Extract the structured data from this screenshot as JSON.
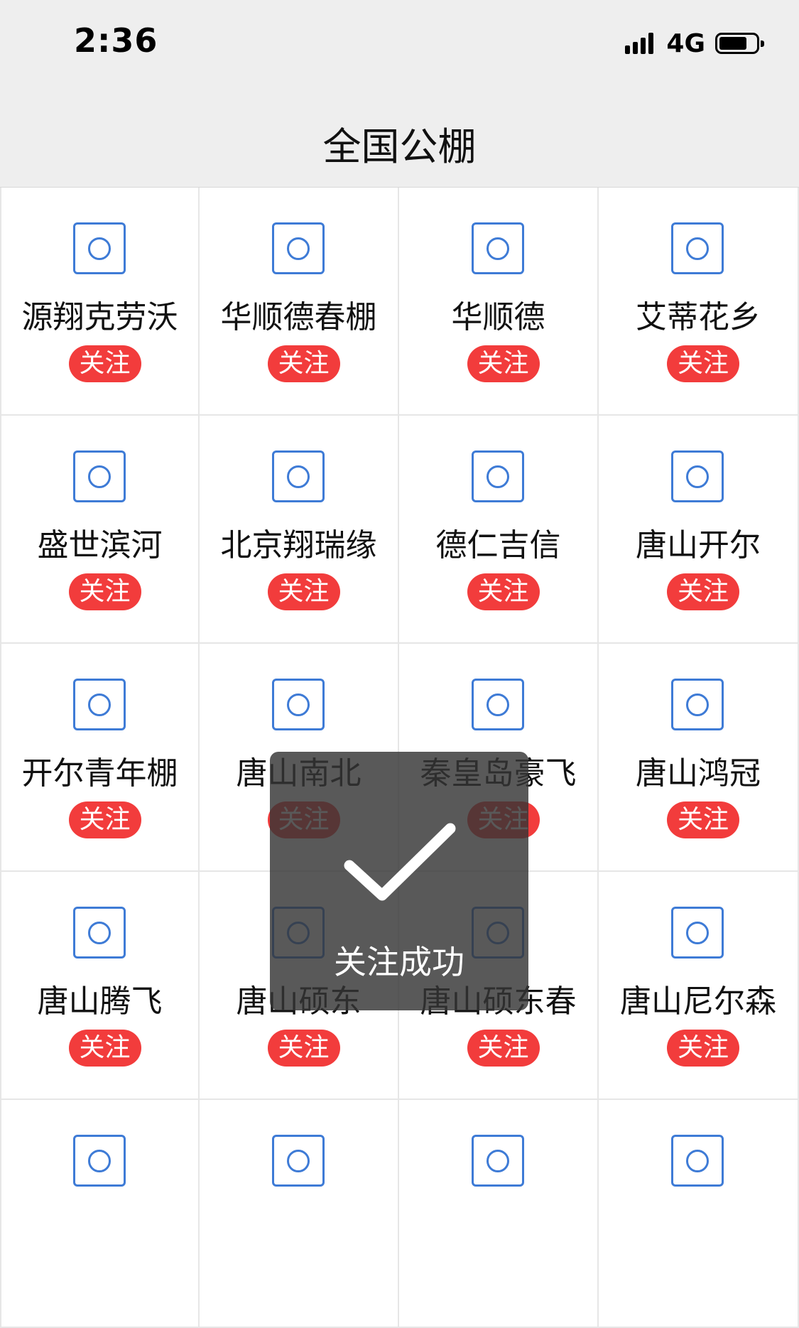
{
  "status_bar": {
    "time": "2:36",
    "network": "4G",
    "signal_bars": 4,
    "battery_level": 0.75
  },
  "header": {
    "title": "全国公棚"
  },
  "follow_label": "关注",
  "items": [
    {
      "name": "源翔克劳沃"
    },
    {
      "name": "华顺德春棚"
    },
    {
      "name": "华顺德"
    },
    {
      "name": "艾蒂花乡"
    },
    {
      "name": "盛世滨河"
    },
    {
      "name": "北京翔瑞缘"
    },
    {
      "name": "德仁吉信"
    },
    {
      "name": "唐山开尔"
    },
    {
      "name": "开尔青年棚"
    },
    {
      "name": "唐山南北"
    },
    {
      "name": "秦皇岛豪飞"
    },
    {
      "name": "唐山鸿冠"
    },
    {
      "name": "唐山腾飞"
    },
    {
      "name": "唐山硕东"
    },
    {
      "name": "唐山硕东春"
    },
    {
      "name": "唐山尼尔森"
    },
    {
      "name": ""
    },
    {
      "name": ""
    },
    {
      "name": ""
    },
    {
      "name": ""
    }
  ],
  "toast": {
    "message": "关注成功",
    "icon": "checkmark-icon"
  },
  "colors": {
    "accent_blue": "#3e7bd6",
    "follow_red": "#f23c3c",
    "header_bg": "#eeeeee"
  }
}
